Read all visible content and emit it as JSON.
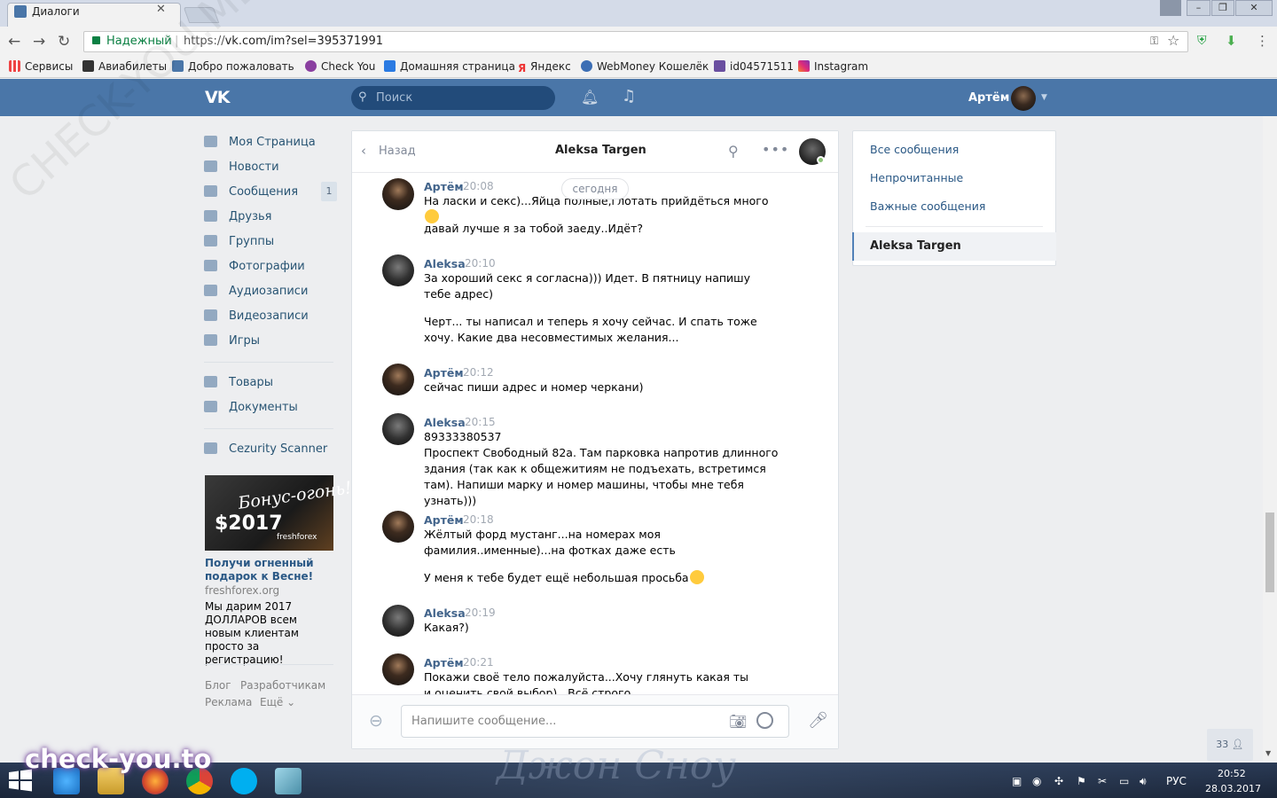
{
  "browser": {
    "tab_title": "Диалоги",
    "tab_close": "✕",
    "secure_label": "Надежный",
    "url_prefix": "https://",
    "url": "vk.com/im?sel=395371991",
    "bookmarks": [
      "Сервисы",
      "Авиабилеты",
      "Добро пожаловать",
      "Check You",
      "Домашняя страница",
      "Яндекс",
      "WebMoney Кошелёк",
      "id04571511",
      "Instagram"
    ]
  },
  "vk": {
    "logo": "VK",
    "search_placeholder": "Поиск",
    "user_name": "Артём",
    "menu": [
      {
        "label": "Моя Страница",
        "icon": "home-icon"
      },
      {
        "label": "Новости",
        "icon": "news-icon"
      },
      {
        "label": "Сообщения",
        "icon": "messages-icon",
        "badge": "1"
      },
      {
        "label": "Друзья",
        "icon": "friends-icon"
      },
      {
        "label": "Группы",
        "icon": "groups-icon"
      },
      {
        "label": "Фотографии",
        "icon": "photos-icon"
      },
      {
        "label": "Аудиозаписи",
        "icon": "audio-icon"
      },
      {
        "label": "Видеозаписи",
        "icon": "video-icon"
      },
      {
        "label": "Игры",
        "icon": "games-icon"
      },
      {
        "label": "Товары",
        "icon": "market-icon"
      },
      {
        "label": "Документы",
        "icon": "docs-icon"
      },
      {
        "label": "Cezurity Scanner",
        "icon": "app-icon"
      }
    ],
    "ad": {
      "image_bonus": "Бонус-огонь!",
      "image_amount": "$2017",
      "image_brand": "freshforex",
      "title": "Получи огненный подарок к Весне!",
      "domain": "freshforex.org",
      "description": "Мы дарим 2017 ДОЛЛАРОВ всем новым клиентам просто за регистрацию!"
    },
    "footer": [
      "Блог",
      "Разработчикам",
      "Реклама",
      "Ещё ⌄"
    ]
  },
  "dialog": {
    "back_label": "Назад",
    "peer_name": "Aleksa Targen",
    "day_divider": "сегодня",
    "messages": [
      {
        "author": "Артём",
        "time": "20:08",
        "lines": [
          "На ласки и секс)...Яйца полные,глотать прийдёться много",
          "давай лучше я за тобой заеду..Идёт?"
        ]
      },
      {
        "author": "Aleksa",
        "time": "20:10",
        "lines": [
          "За хороший секс я согласна))) Идет. В пятницу напишу тебе адрес)",
          "Черт... ты написал и теперь я хочу сейчас. И спать тоже хочу. Какие два несовместимых желания..."
        ]
      },
      {
        "author": "Артём",
        "time": "20:12",
        "lines": [
          "сейчас пиши адрес и номер черкани)"
        ]
      },
      {
        "author": "Aleksa",
        "time": "20:15",
        "lines": [
          "89333380537",
          "Проспект Свободный 82а. Там парковка напротив длинного здания (так как к общежитиям не подъехать, встретимся там). Напиши марку и номер машины, чтобы мне тебя узнать)))"
        ]
      },
      {
        "author": "Артём",
        "time": "20:18",
        "lines": [
          "Жёлтый форд мустанг...на номерах моя фамилия..именные)...на фотках даже есть",
          "У меня к тебе будет ещё небольшая просьба"
        ]
      },
      {
        "author": "Aleksa",
        "time": "20:19",
        "lines": [
          "Какая?)"
        ]
      },
      {
        "author": "Артём",
        "time": "20:21",
        "lines": [
          "Покажи своё тело пожалуйста...Хочу глянуть какая ты и оценить свой выбор)...Всё строго конфиденциально!...В этом"
        ]
      }
    ],
    "compose_placeholder": "Напишите сообщение..."
  },
  "filters": {
    "items": [
      "Все сообщения",
      "Непрочитанные",
      "Важные сообщения"
    ],
    "active": "Aleksa Targen"
  },
  "online_counter": "33",
  "taskbar": {
    "lang": "РУС",
    "time": "20:52",
    "date": "28.03.2017"
  },
  "watermarks": {
    "diagonal": "CHECK-YOU.ME",
    "bottom": "check-you.to",
    "movie": "Джон Сноу"
  },
  "colors": {
    "vk_header": "#4a76a8",
    "link": "#2a5885",
    "author": "#42648b",
    "page_bg": "#edeef0"
  }
}
